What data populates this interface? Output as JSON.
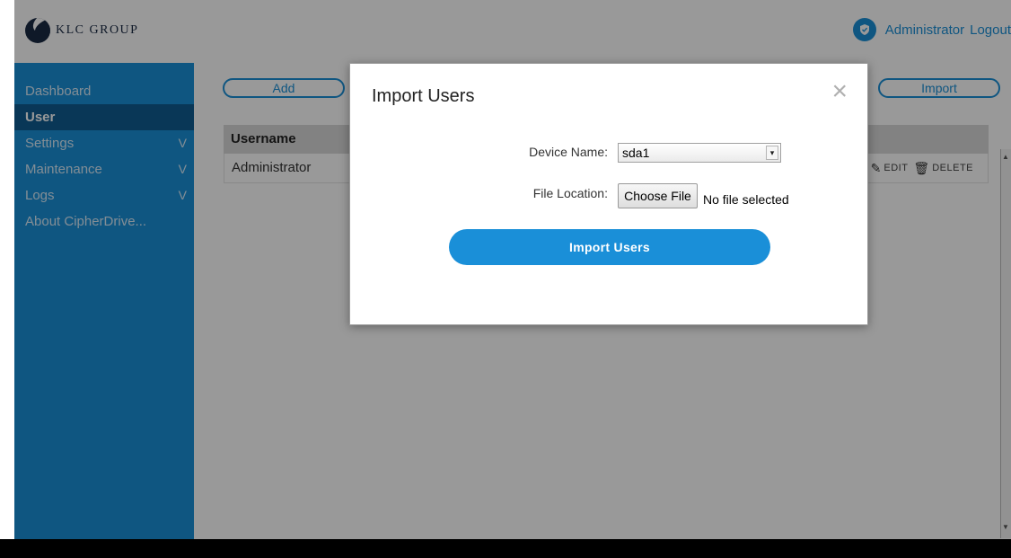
{
  "header": {
    "logo_text": "KLC GROUP",
    "admin_label": "Administrator",
    "logout_label": "Logout"
  },
  "sidebar": {
    "items": [
      {
        "label": "Dashboard",
        "active": false,
        "chevron": ""
      },
      {
        "label": "User",
        "active": true,
        "chevron": ""
      },
      {
        "label": "Settings",
        "active": false,
        "chevron": "V"
      },
      {
        "label": "Maintenance",
        "active": false,
        "chevron": "V"
      },
      {
        "label": "Logs",
        "active": false,
        "chevron": "V"
      },
      {
        "label": "About CipherDrive...",
        "active": false,
        "chevron": ""
      }
    ]
  },
  "main": {
    "add_label": "Add",
    "import_label": "Import",
    "table": {
      "header": "Username",
      "rows": [
        {
          "username": "Administrator",
          "edit_label": "EDIT",
          "delete_label": "DELETE"
        }
      ]
    }
  },
  "modal": {
    "title": "Import Users",
    "close_glyph": "×",
    "device_label": "Device Name:",
    "device_value": "sda1",
    "file_label": "File Location:",
    "choose_file_label": "Choose File",
    "no_file_text": "No file selected",
    "submit_label": "Import Users"
  },
  "colors": {
    "accent": "#1a8fd8",
    "sidebar_active": "#0f5c91",
    "brand_dark": "#1a2a44"
  },
  "icons": {
    "logo": "klc-logo-icon",
    "user_badge": "shield-icon",
    "edit": "pencil-icon",
    "delete": "trash-icon",
    "close": "close-icon",
    "select": "dropdown-arrow-icon"
  }
}
